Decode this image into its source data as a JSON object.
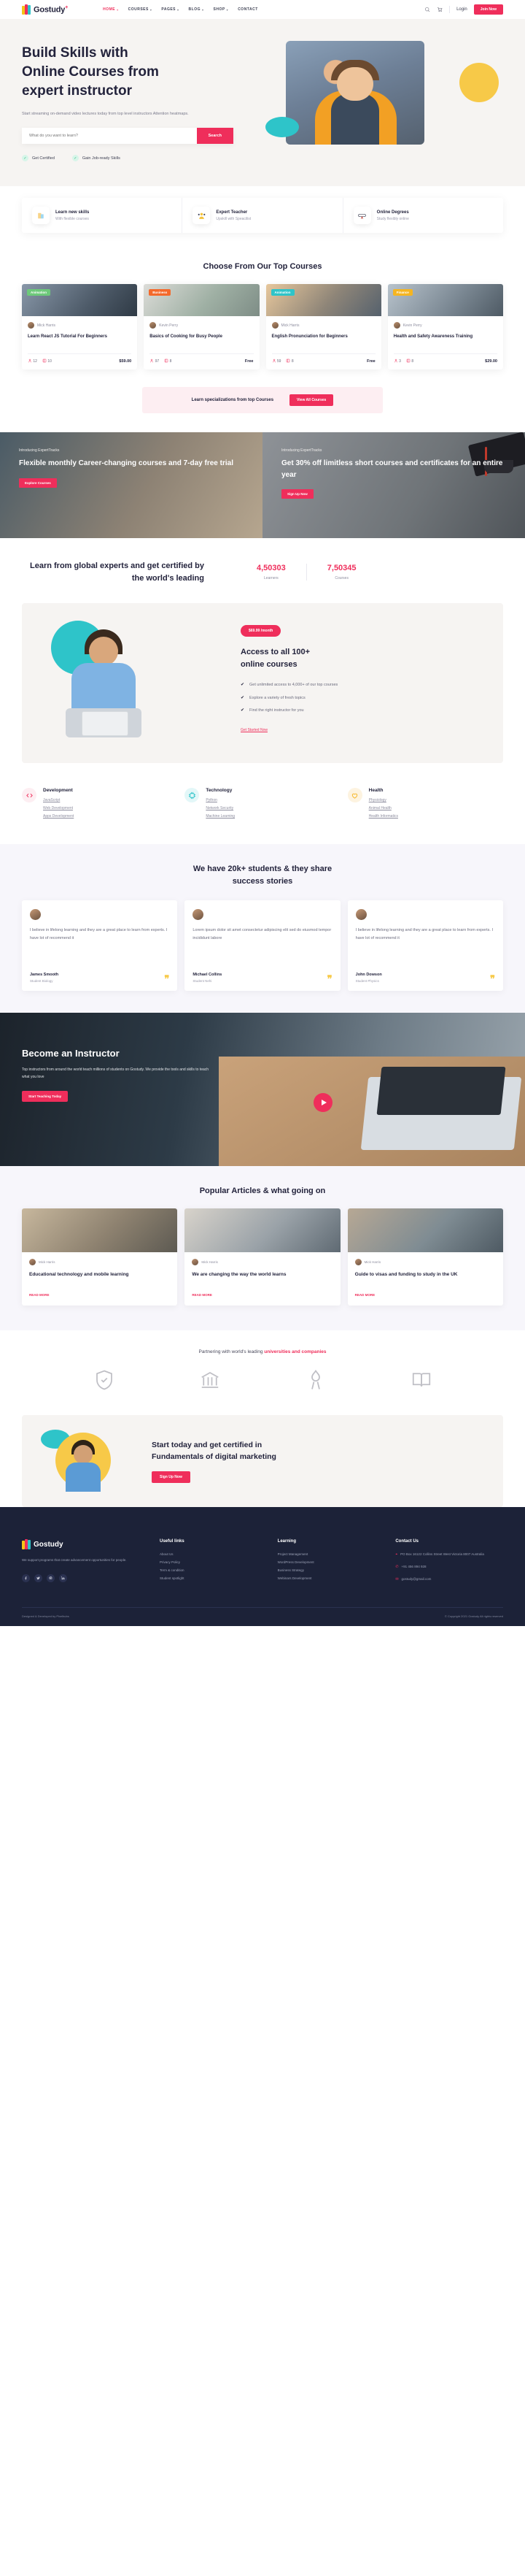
{
  "brand": {
    "name": "Gostudy",
    "plus": "+"
  },
  "nav": {
    "items": [
      {
        "label": "HOME",
        "caret": true,
        "active": true
      },
      {
        "label": "COURSES",
        "caret": true,
        "active": false
      },
      {
        "label": "PAGES",
        "caret": true,
        "active": false
      },
      {
        "label": "BLOG",
        "caret": true,
        "active": false
      },
      {
        "label": "SHOP",
        "caret": true,
        "active": false
      },
      {
        "label": "CONTACT",
        "caret": false,
        "active": false
      }
    ],
    "search_icon": "search-icon",
    "cart_icon": "cart-icon",
    "login": "Login",
    "join": "Join Now"
  },
  "hero": {
    "title_line1": "Build Skills with",
    "title_line2": "Online Courses from",
    "title_line3": "expert instructor",
    "subtitle": "Start streaming on-demand video lectures today from top level instructors Attention heatmaps.",
    "search_placeholder": "What do you want to learn?",
    "search_button": "Search",
    "check1": "Get Certified",
    "check2": "Gain Job-ready Skills"
  },
  "features": [
    {
      "title": "Learn new skills",
      "sub": "With flexible courses",
      "icon": "books-icon"
    },
    {
      "title": "Expert Teacher",
      "sub": "Upskill with Speacilist",
      "icon": "people-icon"
    },
    {
      "title": "Online Degrees",
      "sub": "Study flexibly online",
      "icon": "diploma-icon"
    }
  ],
  "courses": {
    "title": "Choose From Our Top Courses",
    "cards": [
      {
        "badge": "Animation",
        "badge_color": "#6dc97a",
        "author": "Mick Harris",
        "title": "Learn React JS Tutorial For Beginners",
        "students": "12",
        "lessons": "10",
        "price": "$59.00"
      },
      {
        "badge": "Business",
        "badge_color": "#f4692b",
        "author": "Kevin Perry",
        "title": "Basics of Cooking for Busy People",
        "students": "97",
        "lessons": "8",
        "price": "Free"
      },
      {
        "badge": "Animation",
        "badge_color": "#2ec4c9",
        "author": "Mick Harris",
        "title": "English Pronunciation for Beginners",
        "students": "59",
        "lessons": "8",
        "price": "Free"
      },
      {
        "badge": "Finance",
        "badge_color": "#f5b521",
        "author": "Kevin Perry",
        "title": "Health and Safety Awareness Training",
        "students": "3",
        "lessons": "8",
        "price": "$29.00"
      }
    ],
    "promo_text": "Learn specializations from top Courses",
    "promo_button": "View All Courses"
  },
  "banners": [
    {
      "kicker": "Introducing ExpertTracks",
      "title": "Flexible monthly Career-changing courses and 7-day free trial",
      "button": "Explore Courses"
    },
    {
      "kicker": "Introducing ExpertTracks",
      "title": "Get 30% off limitless short courses and certificates for an entire year",
      "button": "Sign Up Now"
    }
  ],
  "stats": {
    "heading": "Learn from global experts and get certified by the world's leading",
    "items": [
      {
        "number": "4,50303",
        "label": "Learners"
      },
      {
        "number": "7,50345",
        "label": "Courses"
      }
    ]
  },
  "access": {
    "price_pill": "$69.99 /month",
    "title_line1": "Access to all 100+",
    "title_line2": "online courses",
    "bullets": [
      "Get unlimited access to 4,000+ of our top courses",
      "Explore a variety of fresh topics",
      "Find the right instructor for you"
    ],
    "link": "Get Started Now"
  },
  "categories": [
    {
      "title": "Development",
      "icon": "code-icon",
      "color": "#fdeef2",
      "links": [
        "JavaScript",
        "Web Development",
        "Apps Development"
      ]
    },
    {
      "title": "Technology",
      "icon": "chip-icon",
      "color": "#e3f7f8",
      "links": [
        "Python",
        "Network Security",
        "Machine Learning"
      ]
    },
    {
      "title": "Health",
      "icon": "heart-icon",
      "color": "#fdf3e0",
      "links": [
        "Physiology",
        "Animal Health",
        "Health Informatics"
      ]
    }
  ],
  "testimonials": {
    "title_line1": "We have 20k+ students & they share",
    "title_line2": "success stories",
    "cards": [
      {
        "text": "I believe in lifelong learning and they are a great place to learn from experts. I have lot of recommend it",
        "name": "James Smooth",
        "role": "Student Biology"
      },
      {
        "text": "Lorem ipsum dolor sit amet consectetur adipiscing elit sed do eiusmod tempor incididunt labore",
        "name": "Michael Collins",
        "role": "Student Nehi"
      },
      {
        "text": "I believe in lifelong learning and they are a great place to learn from experts. I have lot of recommend it",
        "name": "John Dowson",
        "role": "Student Physics"
      }
    ]
  },
  "instructor": {
    "title": "Become an Instructor",
    "sub": "Top instructors from around the world teach millions of students on Gostudy. We provide the tools and skills to teach what you love",
    "button": "Start Teaching Today",
    "play_icon": "play-icon"
  },
  "articles": {
    "title": "Popular Articles & what going on",
    "cards": [
      {
        "author": "Mick Harris",
        "title": "Educational technology and mobile learning",
        "more": "READ MORE"
      },
      {
        "author": "Mick Harris",
        "title": "We are changing the way the world learns",
        "more": "READ MORE"
      },
      {
        "author": "Mick Harris",
        "title": "Guide to visas and funding to study in the UK",
        "more": "READ MORE"
      }
    ]
  },
  "partners": {
    "head_plain": "Partnering with world's leading ",
    "head_bold": "universities and companies",
    "logos": [
      "shield-logo",
      "bank-logo",
      "torch-logo",
      "book-logo"
    ]
  },
  "cta": {
    "title_line1": "Start today and get certified in",
    "title_line2": "Fundamentals of digital marketing",
    "button": "Sign Up Now"
  },
  "footer": {
    "brand": "Gostudy",
    "desc": "We support programs that create advancement opportunities for people.",
    "social": [
      "facebook-icon",
      "twitter-icon",
      "instagram-icon",
      "linkedin-icon"
    ],
    "columns": [
      {
        "title": "Useful links",
        "links": [
          "About Us",
          "Privacy Policy",
          "Term & condition",
          "Student spotlight"
        ]
      },
      {
        "title": "Learning",
        "links": [
          "Project Management",
          "WordPress Development",
          "Business Strategy",
          "Webinars Development"
        ]
      }
    ],
    "contact_title": "Contact Us",
    "contact_address": "PO Box 16122 Collins Street West Victoria 8007 Australia",
    "contact_phone": "+91 456 894 928",
    "contact_email": "gostudy@gmail.com",
    "copyright_left": "Designed & Developed by Pixelhubs",
    "copyright_right": "© Copyright 2021 Gostudy All rights reserved"
  }
}
